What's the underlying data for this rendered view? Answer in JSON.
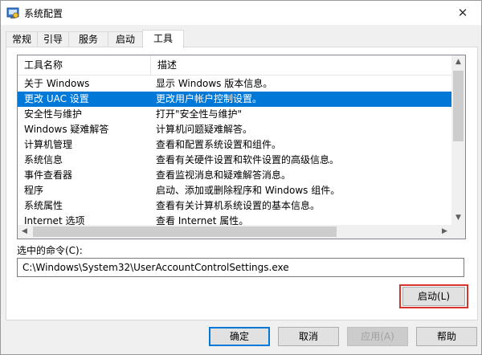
{
  "window": {
    "title": "系统配置",
    "icon": "msconfig-icon",
    "close_glyph": "✕"
  },
  "tabs": [
    {
      "label": "常规"
    },
    {
      "label": "引导"
    },
    {
      "label": "服务"
    },
    {
      "label": "启动"
    },
    {
      "label": "工具",
      "active": true
    }
  ],
  "tools_list": {
    "columns": [
      "工具名称",
      "描述"
    ],
    "selected_index": 1,
    "rows": [
      {
        "name": "关于 Windows",
        "desc": "显示 Windows 版本信息。"
      },
      {
        "name": "更改 UAC 设置",
        "desc": "更改用户帐户控制设置。"
      },
      {
        "name": "安全性与维护",
        "desc": "打开\"安全性与维护\""
      },
      {
        "name": "Windows 疑难解答",
        "desc": "计算机问题疑难解答。"
      },
      {
        "name": "计算机管理",
        "desc": "查看和配置系统设置和组件。"
      },
      {
        "name": "系统信息",
        "desc": "查看有关硬件设置和软件设置的高级信息。"
      },
      {
        "name": "事件查看器",
        "desc": "查看监视消息和疑难解答消息。"
      },
      {
        "name": "程序",
        "desc": "启动、添加或删除程序和 Windows 组件。"
      },
      {
        "name": "系统属性",
        "desc": "查看有关计算机系统设置的基本信息。"
      },
      {
        "name": "Internet 选项",
        "desc": "查看 Internet 属性。"
      }
    ]
  },
  "command": {
    "label": "选中的命令(C):",
    "value": "C:\\Windows\\System32\\UserAccountControlSettings.exe"
  },
  "buttons": {
    "launch": "启动(L)",
    "ok": "确定",
    "cancel": "取消",
    "apply": "应用(A)",
    "help": "帮助"
  },
  "colors": {
    "selection": "#0078d7",
    "highlight_border": "#d9342b"
  }
}
